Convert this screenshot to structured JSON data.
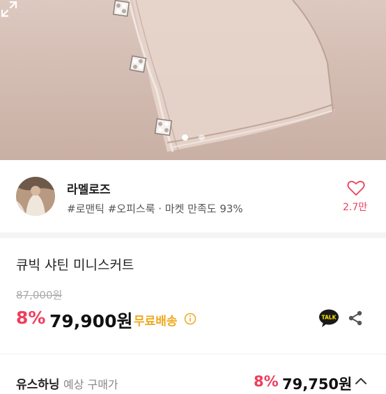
{
  "product_image": {
    "description_icon": "photo-of-pink-satin-skirt-with-crystal-buttons",
    "carousel_total": 2,
    "carousel_active": 1,
    "expand_icon": "expand-arrows-icon"
  },
  "shop": {
    "name": "라멜로즈",
    "tags": "#로맨틱 #오피스룩 · 마켓 만족도 93%",
    "like_count": "2.7만",
    "heart_icon": "heart-outline-icon"
  },
  "product": {
    "title": "큐빅 샤틴 미니스커트",
    "original_price": "87,000원",
    "discount": "8%",
    "price": "79,900원",
    "free_shipping": "무료배송",
    "talk_label": "TALK"
  },
  "expected_purchase": {
    "strong_label": "유스하닝",
    "weak_label": "예상 구매가",
    "discount": "8%",
    "price": "79,750원"
  },
  "colors": {
    "accent": "#ef3e5c",
    "shipping": "#f0a81e",
    "kakao": "#fae100"
  }
}
